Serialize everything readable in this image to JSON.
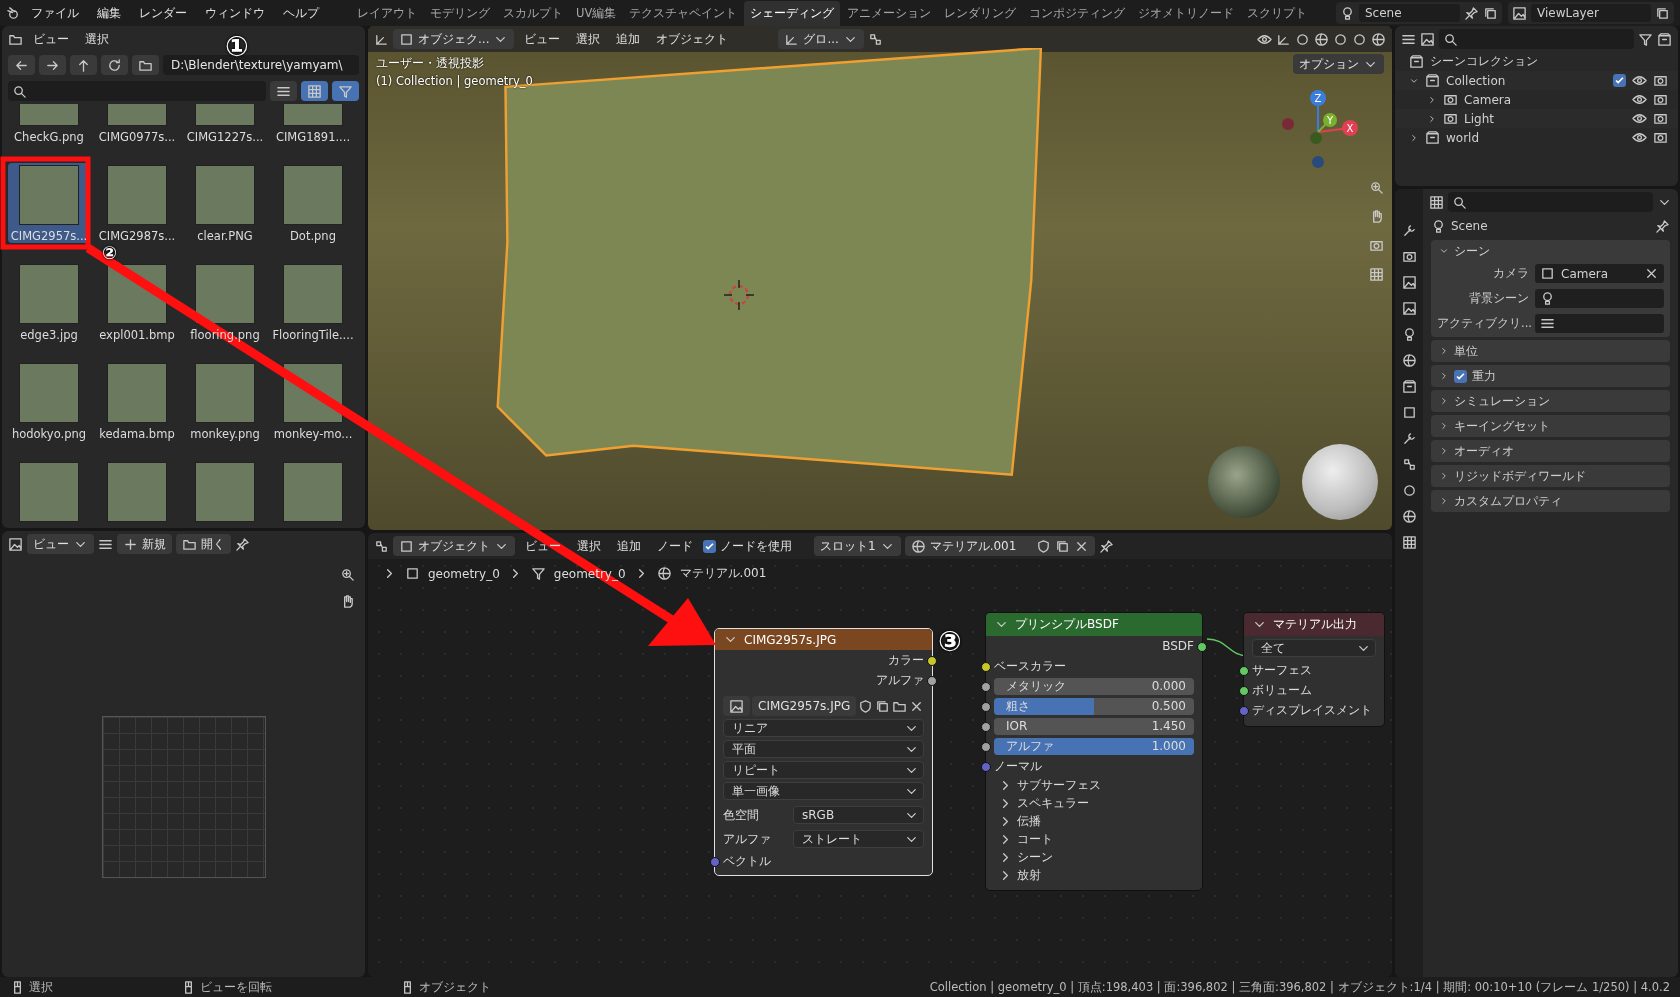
{
  "menu_bar": {
    "items": [
      "ファイル",
      "編集",
      "レンダー",
      "ウィンドウ",
      "ヘルプ"
    ]
  },
  "workspace_tabs": [
    {
      "label": "レイアウト",
      "selected": false
    },
    {
      "label": "モデリング",
      "selected": false
    },
    {
      "label": "スカルプト",
      "selected": false
    },
    {
      "label": "UV編集",
      "selected": false
    },
    {
      "label": "テクスチャペイント",
      "selected": false
    },
    {
      "label": "シェーディング",
      "selected": true
    },
    {
      "label": "アニメーション",
      "selected": false
    },
    {
      "label": "レンダリング",
      "selected": false
    },
    {
      "label": "コンポジティング",
      "selected": false
    },
    {
      "label": "ジオメトリノード",
      "selected": false
    },
    {
      "label": "スクリプト",
      "selected": false
    }
  ],
  "scene": "Scene",
  "view_layer": "ViewLayer",
  "file_browser": {
    "menu": [
      "ビュー",
      "選択"
    ],
    "path": "D:\\Blender\\texture\\yamyam\\",
    "files": [
      {
        "name": "CheckG.png",
        "selected": false
      },
      {
        "name": "CIMG0977s...",
        "selected": false
      },
      {
        "name": "CIMG1227s...",
        "selected": false
      },
      {
        "name": "CIMG1891....",
        "selected": false
      },
      {
        "name": "CIMG2957s...",
        "selected": true
      },
      {
        "name": "CIMG2987s...",
        "selected": false
      },
      {
        "name": "clear.PNG",
        "selected": false
      },
      {
        "name": "Dot.png",
        "selected": false
      },
      {
        "name": "edge3.jpg",
        "selected": false
      },
      {
        "name": "expl001.bmp",
        "selected": false
      },
      {
        "name": "flooring.png",
        "selected": false
      },
      {
        "name": "FlooringTile....",
        "selected": false
      },
      {
        "name": "hodokyo.png",
        "selected": false
      },
      {
        "name": "kedama.bmp",
        "selected": false
      },
      {
        "name": "monkey.png",
        "selected": false
      },
      {
        "name": "monkey-mo...",
        "selected": false
      },
      {
        "selected": false
      },
      {
        "selected": false
      },
      {
        "selected": false
      },
      {
        "selected": false
      }
    ]
  },
  "image_editor": {
    "menu": "ビュー",
    "new_button": "新規",
    "open_button": "開く"
  },
  "viewport": {
    "mode": "オブジェク...",
    "menu": [
      "ビュー",
      "選択",
      "追加",
      "オブジェクト"
    ],
    "transform": "グロ...",
    "options": "オプション",
    "view_name": "ユーザー・透視投影",
    "object_info": "(1) Collection | geometry_0",
    "axes": [
      "Z",
      "Y",
      "X"
    ]
  },
  "node_editor": {
    "mode": "オブジェクト",
    "menu": [
      "ビュー",
      "選択",
      "追加",
      "ノード"
    ],
    "use_nodes": {
      "label": "ノードを使用",
      "checked": true
    },
    "slot": "スロット1",
    "material": "マテリアル.001",
    "breadcrumbs": [
      "geometry_0",
      "geometry_0",
      "マテリアル.001"
    ],
    "image_node": {
      "title": "CIMG2957s.JPG",
      "outputs": [
        {
          "label": "カラー",
          "color": "#c7c729"
        },
        {
          "label": "アルファ",
          "color": "#a1a1a1"
        }
      ],
      "image": "CIMG2957s.JPG",
      "dropdowns": [
        "リニア",
        "平面",
        "リピート",
        "単一画像"
      ],
      "props": [
        {
          "label": "色空間",
          "value": "sRGB"
        },
        {
          "label": "アルファ",
          "value": "ストレート"
        }
      ],
      "input": {
        "label": "ベクトル",
        "color": "#6363c7"
      }
    },
    "bsdf_node": {
      "title": "プリンシプルBSDF",
      "output": {
        "label": "BSDF",
        "color": "#63c763"
      },
      "base": {
        "label": "ベースカラー",
        "color": "#c7c729"
      },
      "sliders": [
        {
          "label": "メタリック",
          "value": "0.000",
          "level": 0
        },
        {
          "label": "粗さ",
          "value": "0.500",
          "level": 0.5
        },
        {
          "label": "IOR",
          "value": "1.450",
          "level": 0
        },
        {
          "label": "アルファ",
          "value": "1.000",
          "level": 1
        }
      ],
      "normal": {
        "label": "ノーマル",
        "color": "#6363c7"
      },
      "panels": [
        "サブサーフェス",
        "スペキュラー",
        "伝播",
        "コート",
        "シーン",
        "放射"
      ]
    },
    "output_node": {
      "title": "マテリアル出力",
      "target": "全て",
      "inputs": [
        {
          "label": "サーフェス",
          "color": "#63c763"
        },
        {
          "label": "ボリューム",
          "color": "#63c763"
        },
        {
          "label": "ディスプレイスメント",
          "color": "#6363c7"
        }
      ]
    }
  },
  "outliner": {
    "root": "シーンコレクション",
    "items": [
      {
        "label": "Collection",
        "expanded": true,
        "checked": true,
        "children": [
          {
            "label": "Camera",
            "expanded": false
          },
          {
            "label": "Light",
            "expanded": false
          }
        ]
      },
      {
        "label": "world",
        "expanded": false
      }
    ]
  },
  "properties": {
    "context": "Scene",
    "panels": [
      {
        "label": "シーン",
        "expanded": true,
        "fields": [
          {
            "label": "カメラ",
            "value": "Camera"
          },
          {
            "label": "背景シーン"
          },
          {
            "label": "アクティブクリ..."
          }
        ]
      },
      {
        "label": "単位",
        "expanded": false
      },
      {
        "label": "重力",
        "expanded": false,
        "checked": true
      },
      {
        "label": "シミュレーション",
        "expanded": false
      },
      {
        "label": "キーイングセット",
        "expanded": false
      },
      {
        "label": "オーディオ",
        "expanded": false
      },
      {
        "label": "リジッドボディワールド",
        "expanded": false
      },
      {
        "label": "カスタムプロパティ",
        "expanded": false
      }
    ]
  },
  "status_bar": {
    "hints": [
      "選択",
      "ビューを回転",
      "オブジェクト"
    ],
    "stats": "Collection | geometry_0 | 頂点:198,403 | 面:396,802 | 三角面:396,802 | オブジェクト:1/4 | 期間: 00:10+10 (フレーム 1/250) | 4.0.2"
  },
  "annotations": [
    "①",
    "②",
    "③"
  ]
}
